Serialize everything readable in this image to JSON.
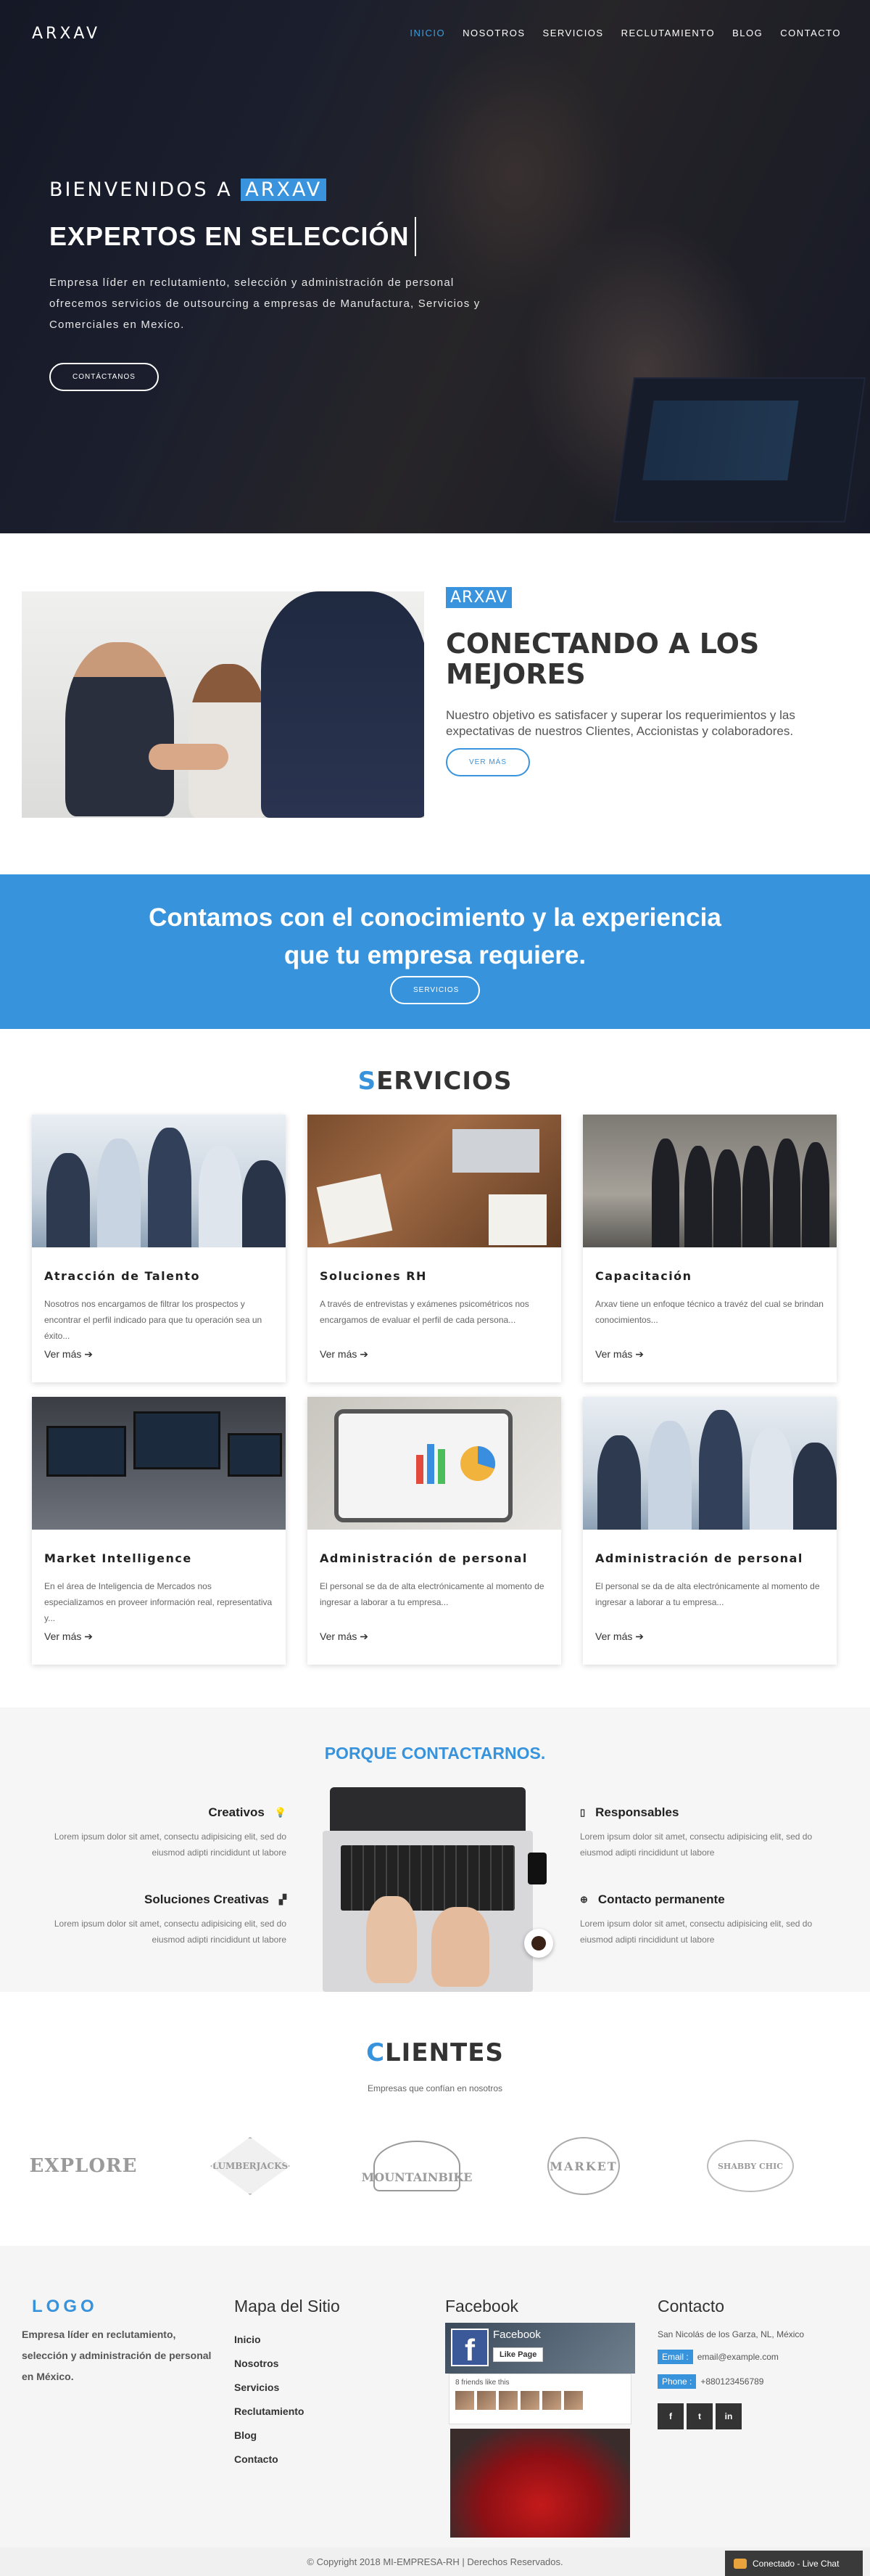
{
  "header": {
    "logo": "ARXAV",
    "menu": [
      {
        "label": "INICIO",
        "active": true
      },
      {
        "label": "NOSOTROS"
      },
      {
        "label": "SERVICIOS"
      },
      {
        "label": "RECLUTAMIENTO"
      },
      {
        "label": "BLOG"
      },
      {
        "label": "CONTACTO"
      }
    ]
  },
  "hero": {
    "welcome": "BIENVENIDOS A",
    "brand": "ARXAV",
    "title_a": "EXPERTOS EN",
    "title_b": "SELECCIÓN",
    "description": "Empresa líder en reclutamiento, selección y administración de personal ofrecemos servicios de outsourcing a empresas de Manufactura, Servicios y Comerciales en Mexico.",
    "button": "CONTÁCTANOS"
  },
  "about": {
    "tag": "ARXAV",
    "title": "CONECTANDO A LOS MEJORES",
    "description": "Nuestro objetivo es satisfacer y superar los requerimientos y las expectativas de nuestros Clientes, Accionistas y colaboradores.",
    "button": "VER MÁS"
  },
  "banner": {
    "title_line1": "Contamos con el conocimiento y la experiencia",
    "title_line2": "que tu empresa requiere.",
    "button": "SERVICIOS"
  },
  "services": {
    "title_first": "S",
    "title_rest": "ERVICIOS",
    "more_label": "Ver más ➔",
    "cards": [
      {
        "title": "Atracción de Talento",
        "text": "Nosotros nos encargamos de filtrar los prospectos y encontrar el perfil indicado para que tu operación sea un éxito..."
      },
      {
        "title": "Soluciones RH",
        "text": "A través de entrevistas y exámenes psicométricos nos encargamos de evaluar el perfil de cada persona..."
      },
      {
        "title": "Capacitación",
        "text": "Arxav tiene un enfoque técnico a travéz del cual se brindan conocimientos..."
      },
      {
        "title": "Market Intelligence",
        "text": "En el área de Inteligencia de Mercados nos especializamos en proveer información real, representativa y..."
      },
      {
        "title": "Administración de personal",
        "text": "El personal se da de alta electrónicamente al momento de ingresar a laborar a tu empresa..."
      },
      {
        "title": "Administración de personal",
        "text": "El personal se da de alta electrónicamente al momento de ingresar a laborar a tu empresa..."
      }
    ]
  },
  "why": {
    "title": "PORQUE CONTACTARNOS.",
    "features": [
      {
        "title": "Creativos",
        "text": "Lorem ipsum dolor sit amet, consectu adipisicing elit, sed do eiusmod adipti rincididunt ut labore",
        "icon": "lightbulb-icon"
      },
      {
        "title": "Soluciones Creativas",
        "text": "Lorem ipsum dolor sit amet, consectu adipisicing elit, sed do eiusmod adipti rincididunt ut labore",
        "icon": "puzzle-icon"
      },
      {
        "title": "Responsables",
        "text": "Lorem ipsum dolor sit amet, consectu adipisicing elit, sed do eiusmod adipti rincididunt ut labore",
        "icon": "mobile-icon"
      },
      {
        "title": "Contacto permanente",
        "text": "Lorem ipsum dolor sit amet, consectu adipisicing elit, sed do eiusmod adipti rincididunt ut labore",
        "icon": "lifebuoy-icon"
      }
    ]
  },
  "clients": {
    "title_first": "C",
    "title_rest": "LIENTES",
    "subtitle": "Empresas que confían en nosotros",
    "logos": [
      "EXPLORE",
      "LUMBERJACKS",
      "MOUNTAINBIKE",
      "MARKET",
      "SHABBY CHIC"
    ]
  },
  "footer": {
    "logo": "LOGO",
    "about": "Empresa líder en reclutamiento, selección y administración de personal en México.",
    "map_title": "Mapa del Sitio",
    "map_links": [
      "Inicio",
      "Nosotros",
      "Servicios",
      "Reclutamiento",
      "Blog",
      "Contacto"
    ],
    "facebook_title": "Facebook",
    "fb_page": "Facebook",
    "fb_like": "Like Page",
    "fb_friends": "8 friends like this",
    "contact_title": "Contacto",
    "address": "San Nicolás de los Garza, NL, México",
    "email_label": "Email :",
    "email": "email@example.com",
    "phone_label": "Phone :",
    "phone": "+880123456789",
    "social": [
      "f",
      "t",
      "in"
    ]
  },
  "copyright": "© Copyright 2018 MI-EMPRESA-RH | Derechos Reservados.",
  "chat": "Conectado - Live Chat",
  "colors": {
    "accent": "#3893dd",
    "dark": "#333333"
  }
}
